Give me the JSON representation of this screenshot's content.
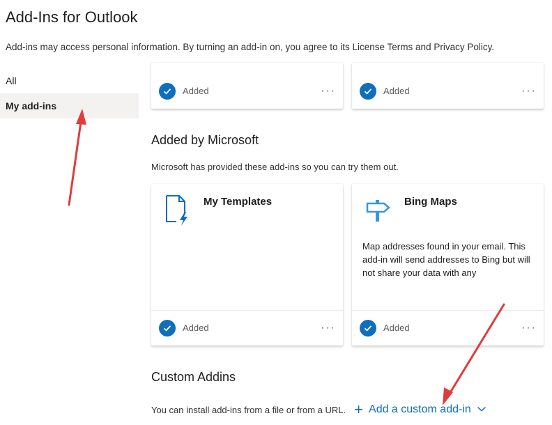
{
  "header": {
    "title": "Add-Ins for Outlook",
    "subtitle": "Add-ins may access personal information. By turning an add-in on, you agree to its License Terms and Privacy Policy."
  },
  "nav": {
    "items": [
      {
        "label": "All"
      },
      {
        "label": "My add-ins"
      }
    ]
  },
  "top_cards": [
    {
      "status": "Added",
      "more": "···"
    },
    {
      "status": "Added",
      "more": "···"
    }
  ],
  "microsoft_section": {
    "title": "Added by Microsoft",
    "description": "Microsoft has provided these add-ins so you can try them out.",
    "cards": [
      {
        "name": "My Templates",
        "icon": "document-lightning-icon",
        "description": "",
        "status": "Added",
        "more": "···"
      },
      {
        "name": "Bing Maps",
        "icon": "signpost-icon",
        "description": "Map addresses found in your email. This add-in will send addresses to Bing but will not share your data with any",
        "status": "Added",
        "more": "···"
      }
    ]
  },
  "custom_section": {
    "title": "Custom Addins",
    "description": "You can install add-ins from a file or from a URL.",
    "add_label": "Add a custom add-in"
  },
  "colors": {
    "accent": "#106ebe",
    "link": "#0f6cbd",
    "annotation_arrow": "#e03c3c",
    "selected_nav_bg": "#f3f2f1"
  }
}
